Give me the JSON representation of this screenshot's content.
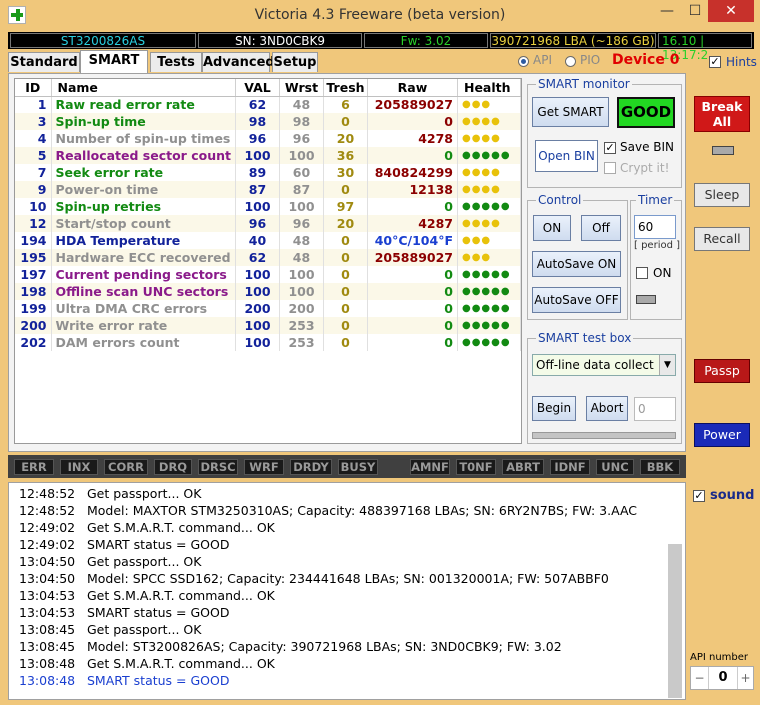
{
  "window": {
    "title": "Victoria 4.3 Freeware (beta version)",
    "minimize": "—",
    "maximize": "☐",
    "close": "✕"
  },
  "infobar": {
    "model": "ST3200826AS",
    "serial": "SN: 3ND0CBK9",
    "firmware": "Fw: 3.02",
    "lba": "390721968 LBA (~186 GB)",
    "time": "16.10 | 13:17:2"
  },
  "tabs": [
    "Standard",
    "SMART",
    "Tests",
    "Advanced",
    "Setup"
  ],
  "mode": {
    "api": "API",
    "pio": "PIO",
    "selected": "API"
  },
  "device": "Device 0",
  "hints": {
    "label": "Hints",
    "checked": true
  },
  "smart_table": {
    "headers": [
      "ID",
      "Name",
      "VAL",
      "Wrst",
      "Tresh",
      "Raw",
      "Health"
    ],
    "rows": [
      {
        "id": "1",
        "name": "Raw read error rate",
        "val": "62",
        "wrst": "48",
        "tresh": "6",
        "raw": "205889027",
        "health": "●●●",
        "name_color": "#128a12",
        "raw_color": "#8b0000",
        "health_color": "#e8c20a"
      },
      {
        "id": "3",
        "name": "Spin-up time",
        "val": "98",
        "wrst": "98",
        "tresh": "0",
        "raw": "0",
        "health": "●●●●",
        "name_color": "#128a12",
        "raw_color": "#8b0000",
        "health_color": "#e8c20a"
      },
      {
        "id": "4",
        "name": "Number of spin-up times",
        "val": "96",
        "wrst": "96",
        "tresh": "20",
        "raw": "4278",
        "health": "●●●●",
        "name_color": "#909090",
        "raw_color": "#8b0000",
        "health_color": "#e8c20a"
      },
      {
        "id": "5",
        "name": "Reallocated sector count",
        "val": "100",
        "wrst": "100",
        "tresh": "36",
        "raw": "0",
        "health": "●●●●●",
        "name_color": "#8a1a8a",
        "raw_color": "#128a12",
        "health_color": "#128a12"
      },
      {
        "id": "7",
        "name": "Seek error rate",
        "val": "89",
        "wrst": "60",
        "tresh": "30",
        "raw": "840824299",
        "health": "●●●●",
        "name_color": "#128a12",
        "raw_color": "#8b0000",
        "health_color": "#e8c20a"
      },
      {
        "id": "9",
        "name": "Power-on time",
        "val": "87",
        "wrst": "87",
        "tresh": "0",
        "raw": "12138",
        "health": "●●●●",
        "name_color": "#909090",
        "raw_color": "#8b0000",
        "health_color": "#e8c20a"
      },
      {
        "id": "10",
        "name": "Spin-up retries",
        "val": "100",
        "wrst": "100",
        "tresh": "97",
        "raw": "0",
        "health": "●●●●●",
        "name_color": "#128a12",
        "raw_color": "#128a12",
        "health_color": "#128a12"
      },
      {
        "id": "12",
        "name": "Start/stop count",
        "val": "96",
        "wrst": "96",
        "tresh": "20",
        "raw": "4287",
        "health": "●●●●",
        "name_color": "#909090",
        "raw_color": "#8b0000",
        "health_color": "#e8c20a"
      },
      {
        "id": "194",
        "name": "HDA Temperature",
        "val": "40",
        "wrst": "48",
        "tresh": "0",
        "raw": "40°C/104°F",
        "health": "●●●",
        "name_color": "#12229a",
        "raw_color": "#1a3fd0",
        "health_color": "#e8c20a"
      },
      {
        "id": "195",
        "name": "Hardware ECC recovered",
        "val": "62",
        "wrst": "48",
        "tresh": "0",
        "raw": "205889027",
        "health": "●●●",
        "name_color": "#909090",
        "raw_color": "#8b0000",
        "health_color": "#e8c20a"
      },
      {
        "id": "197",
        "name": "Current pending sectors",
        "val": "100",
        "wrst": "100",
        "tresh": "0",
        "raw": "0",
        "health": "●●●●●",
        "name_color": "#8a1a8a",
        "raw_color": "#128a12",
        "health_color": "#128a12"
      },
      {
        "id": "198",
        "name": "Offline scan UNC sectors",
        "val": "100",
        "wrst": "100",
        "tresh": "0",
        "raw": "0",
        "health": "●●●●●",
        "name_color": "#8a1a8a",
        "raw_color": "#128a12",
        "health_color": "#128a12"
      },
      {
        "id": "199",
        "name": "Ultra DMA CRC errors",
        "val": "200",
        "wrst": "200",
        "tresh": "0",
        "raw": "0",
        "health": "●●●●●",
        "name_color": "#909090",
        "raw_color": "#128a12",
        "health_color": "#128a12"
      },
      {
        "id": "200",
        "name": "Write error rate",
        "val": "100",
        "wrst": "253",
        "tresh": "0",
        "raw": "0",
        "health": "●●●●●",
        "name_color": "#909090",
        "raw_color": "#128a12",
        "health_color": "#128a12"
      },
      {
        "id": "202",
        "name": "DAM errors count",
        "val": "100",
        "wrst": "253",
        "tresh": "0",
        "raw": "0",
        "health": "●●●●●",
        "name_color": "#909090",
        "raw_color": "#128a12",
        "health_color": "#128a12"
      }
    ]
  },
  "smart_monitor": {
    "title": "SMART monitor",
    "get_smart": "Get SMART",
    "status": "GOOD",
    "open_bin": "Open BIN",
    "save_bin": "Save BIN",
    "save_bin_checked": true,
    "crypt": "Crypt it!"
  },
  "control": {
    "title": "Control",
    "on": "ON",
    "off": "Off",
    "autosave_on": "AutoSave ON",
    "autosave_off": "AutoSave OFF"
  },
  "timer": {
    "title": "Timer",
    "value": "60",
    "period": "[ period ]",
    "on_label": "ON"
  },
  "test_box": {
    "title": "SMART test box",
    "selected": "Off-line data collect",
    "begin": "Begin",
    "abort": "Abort",
    "progress": "0"
  },
  "sidebar": {
    "break_all": "Break All",
    "sleep": "Sleep",
    "recall": "Recall",
    "passp": "Passp",
    "power": "Power",
    "sound": "sound",
    "sound_checked": true,
    "api_number_label": "API number",
    "api_number": "0",
    "minus": "−",
    "plus": "+"
  },
  "flags": [
    "ERR",
    "INX",
    "CORR",
    "DRQ",
    "DRSC",
    "WRF",
    "DRDY",
    "BUSY",
    "AMNF",
    "T0NF",
    "ABRT",
    "IDNF",
    "UNC",
    "BBK"
  ],
  "log": [
    {
      "time": "12:48:52",
      "msg": "Get passport... OK",
      "color": "#000000"
    },
    {
      "time": "12:48:52",
      "msg": "Model: MAXTOR STM3250310AS; Capacity: 488397168 LBAs; SN: 6RY2N7BS; FW: 3.AAC",
      "color": "#000000"
    },
    {
      "time": "12:49:02",
      "msg": "Get S.M.A.R.T. command... OK",
      "color": "#000000"
    },
    {
      "time": "12:49:02",
      "msg": "SMART status = GOOD",
      "color": "#000000"
    },
    {
      "time": "13:04:50",
      "msg": "Get passport... OK",
      "color": "#000000"
    },
    {
      "time": "13:04:50",
      "msg": "Model: SPCC SSD162; Capacity: 234441648 LBAs; SN: 001320001A; FW: 507ABBF0",
      "color": "#000000"
    },
    {
      "time": "13:04:53",
      "msg": "Get S.M.A.R.T. command... OK",
      "color": "#000000"
    },
    {
      "time": "13:04:53",
      "msg": "SMART status = GOOD",
      "color": "#000000"
    },
    {
      "time": "13:08:45",
      "msg": "Get passport... OK",
      "color": "#000000"
    },
    {
      "time": "13:08:45",
      "msg": "Model: ST3200826AS; Capacity: 390721968 LBAs; SN: 3ND0CBK9; FW: 3.02",
      "color": "#000000"
    },
    {
      "time": "13:08:48",
      "msg": "Get S.M.A.R.T. command... OK",
      "color": "#000000"
    },
    {
      "time": "13:08:48",
      "msg": "SMART status = GOOD",
      "color": "#1a3fd0"
    }
  ]
}
